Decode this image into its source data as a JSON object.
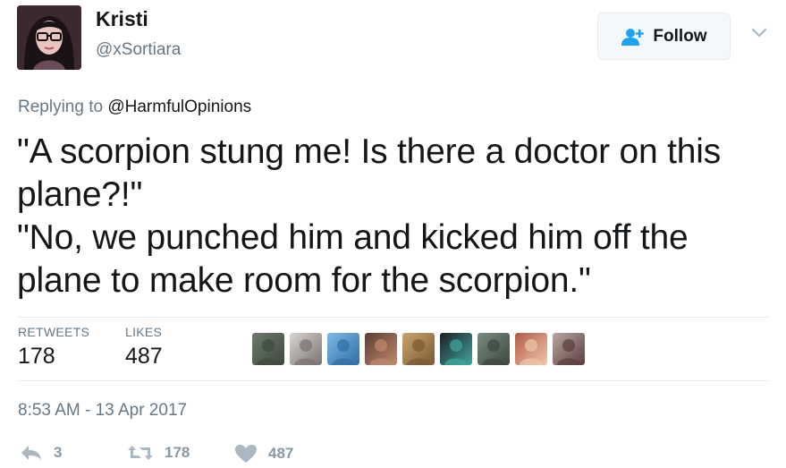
{
  "author": {
    "name": "Kristi",
    "handle": "@xSortiara"
  },
  "header": {
    "follow_label": "Follow",
    "follow_icon": "add-user-icon",
    "caret_icon": "chevron-down-icon"
  },
  "reply": {
    "prefix": "Replying to",
    "mention": "@HarmfulOpinions"
  },
  "tweet": {
    "line1": "\"A scorpion stung me! Is there a doctor on this plane?!\"",
    "line2": "\"No, we punched him and kicked him off the plane to make room for the scorpion.\""
  },
  "stats": {
    "retweets_label": "RETWEETS",
    "retweets_value": "178",
    "likes_label": "LIKES",
    "likes_value": "487"
  },
  "likers": [
    {
      "color": "#6b7a6a",
      "accent": "#3d4a3c"
    },
    {
      "color": "#d8d4cf",
      "accent": "#7a7470"
    },
    {
      "color": "#7fb7e6",
      "accent": "#2e6fa6"
    },
    {
      "color": "#5a3d33",
      "accent": "#c28a6e"
    },
    {
      "color": "#c9a36b",
      "accent": "#7a5a34"
    },
    {
      "color": "#1e1e22",
      "accent": "#3fa7a0"
    },
    {
      "color": "#7a8c80",
      "accent": "#3c4740"
    },
    {
      "color": "#b05a4a",
      "accent": "#f0c7a8"
    },
    {
      "color": "#b9a7a2",
      "accent": "#5a3d3a"
    }
  ],
  "timestamp": "8:53 AM - 13 Apr 2017",
  "actions": {
    "reply_count": "3",
    "retweet_count": "178",
    "like_count": "487"
  },
  "colors": {
    "secondary_text": "#657786",
    "action_icon": "#aab8c2",
    "follow_accent": "#1da1f2"
  }
}
